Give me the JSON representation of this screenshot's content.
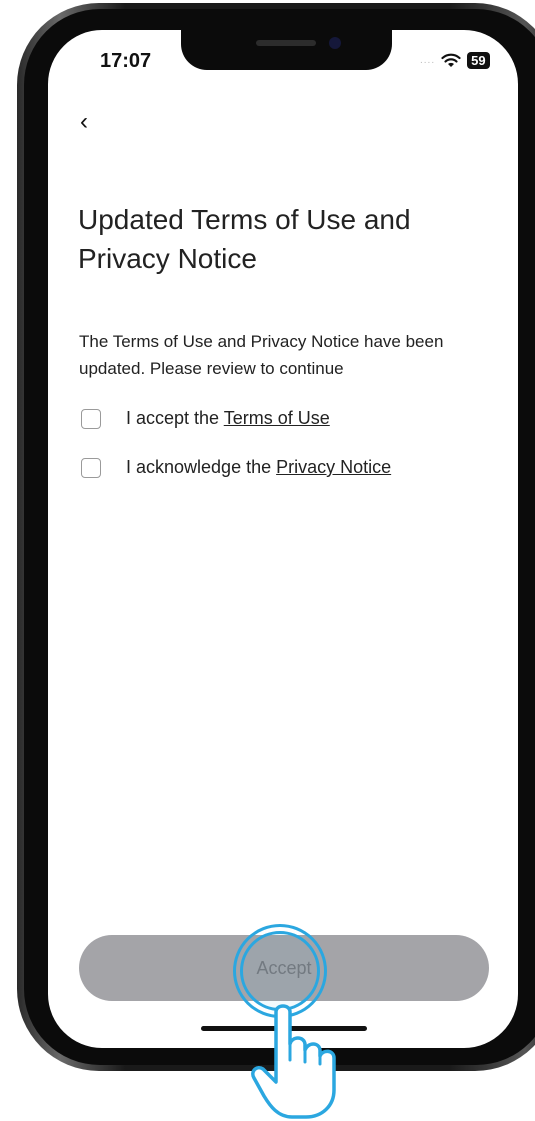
{
  "status_bar": {
    "time": "17:07",
    "signal_dots": "....",
    "wifi_icon": "wifi-icon",
    "battery": "59"
  },
  "nav": {
    "back_label": "‹"
  },
  "header": {
    "title": "Updated Terms of Use and Privacy Notice"
  },
  "body": {
    "description": "The Terms of Use and Privacy Notice have been updated. Please review to continue"
  },
  "consents": [
    {
      "prefix": "I accept the ",
      "link": "Terms of Use",
      "checked": false
    },
    {
      "prefix": "I acknowledge the ",
      "link": "Privacy Notice",
      "checked": false
    }
  ],
  "footer": {
    "accept_label": "Accept",
    "accept_enabled": false
  },
  "colors": {
    "button_disabled": "#a4a4a8",
    "tap_highlight": "#2ba7e0"
  }
}
